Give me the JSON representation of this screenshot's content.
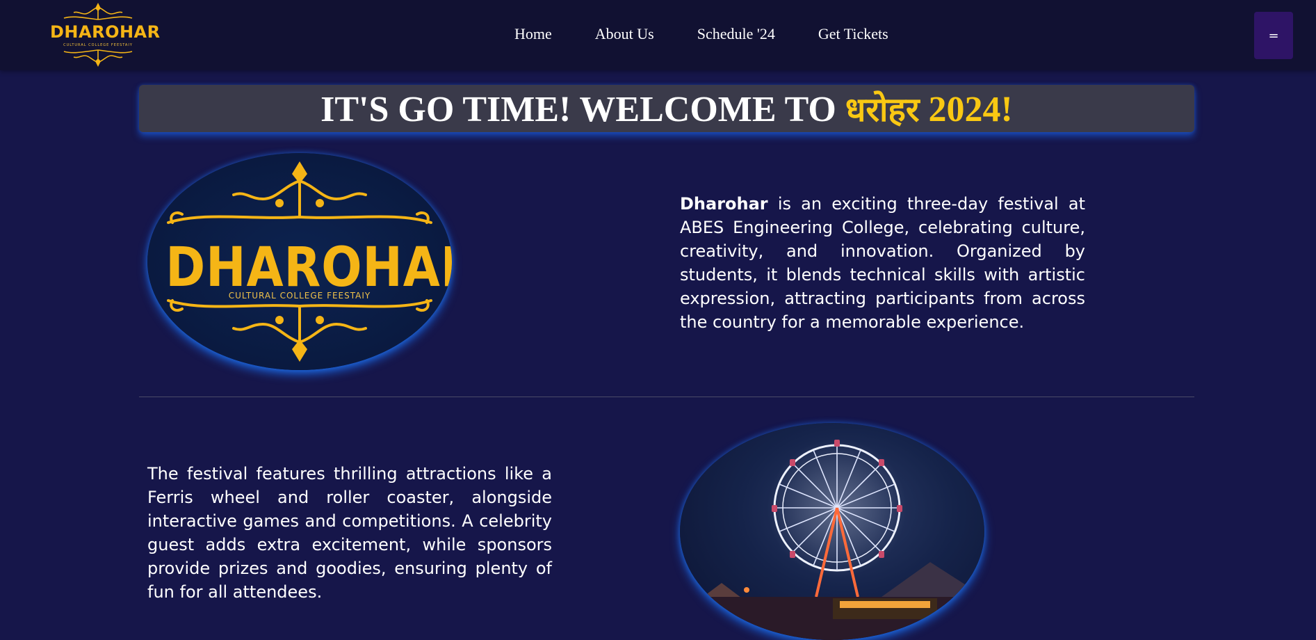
{
  "nav": {
    "logo_text": "DHAROHAR",
    "logo_subtitle": "CULTURAL COLLEGE FEESTAIY",
    "links": [
      "Home",
      "About Us",
      "Schedule '24",
      "Get Tickets"
    ],
    "menu_label": "="
  },
  "hero": {
    "title_prefix": "IT'S GO TIME! WELCOME TO ",
    "title_highlight": "धरोहर",
    "title_year": " 2024!"
  },
  "about": {
    "brand": "Dharohar",
    "text": " is an exciting three-day festival at ABES Engineering College, celebrating culture, creativity, and innovation. Organized by students, it blends technical skills with artistic expression, attracting participants from across the country for a memorable experience."
  },
  "festival_logo": {
    "word": "DHAROHAR",
    "subtitle": "CULTURAL COLLEGE FEESTAIY"
  },
  "attractions": {
    "text": "The festival features thrilling attractions like a Ferris wheel and roller coaster, alongside interactive games and competitions. A celebrity guest adds extra excitement, while sponsors provide prizes and goodies, ensuring plenty of fun for all attendees."
  },
  "images": {
    "ferris_icon": "ferris-wheel-photo"
  },
  "colors": {
    "background": "#16164a",
    "navbar": "#111132",
    "gold": "#f5b516",
    "highlight": "#f9c813",
    "glow": "#1e78ff",
    "menu_button": "#2e1466"
  }
}
